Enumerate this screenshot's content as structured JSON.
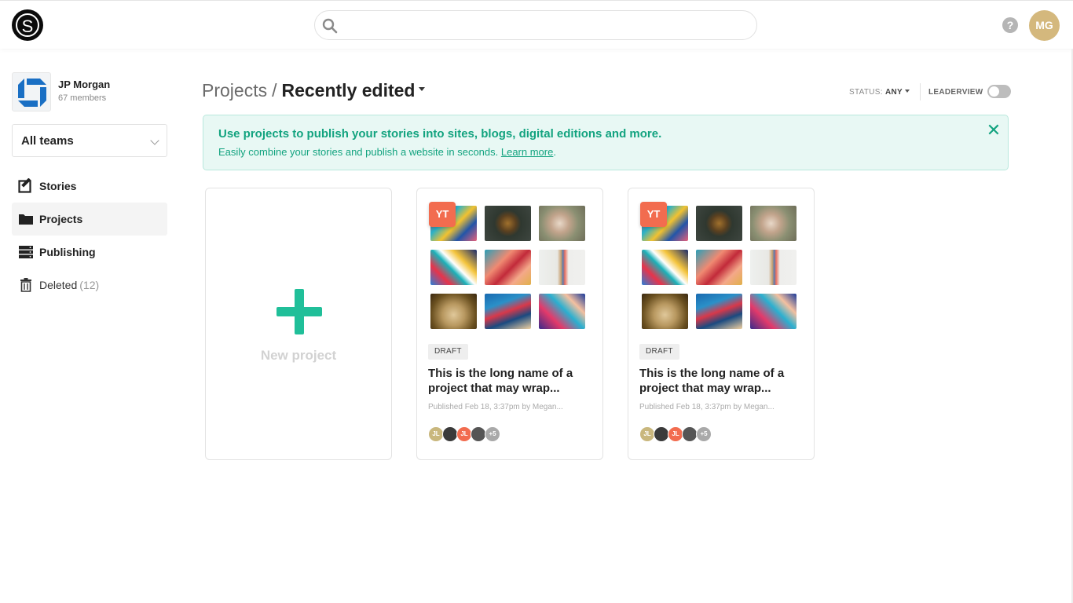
{
  "app": {
    "logo_letter": "S",
    "search_placeholder": "",
    "user_initials": "MG",
    "help_symbol": "?"
  },
  "org": {
    "name": "JP Morgan",
    "members": "67 members"
  },
  "sidebar": {
    "team_select": "All teams",
    "items": [
      {
        "label": "Stories",
        "icon": "edit-icon"
      },
      {
        "label": "Projects",
        "icon": "folder-icon",
        "active": true
      },
      {
        "label": "Publishing",
        "icon": "server-icon"
      },
      {
        "label": "Deleted",
        "icon": "trash-icon",
        "count": "(12)"
      }
    ]
  },
  "header": {
    "crumb_root": "Projects",
    "crumb_sep": "/",
    "crumb_current": "Recently edited",
    "status_label": "STATUS:",
    "status_value": "ANY",
    "leaderview_label": "LEADERVIEW",
    "leaderview_on": false
  },
  "banner": {
    "title": "Use projects to publish your stories into sites, blogs, digital editions and more.",
    "text": "Easily combine your stories and publish a website in seconds. ",
    "link": "Learn more",
    "text_end": ".",
    "close": "✕"
  },
  "new_project": {
    "label": "New project"
  },
  "projects": [
    {
      "badge": "YT",
      "status": "DRAFT",
      "title": "This is the long name of a project that may wrap...",
      "meta": "Published Feb 18, 3:37pm by Megan...",
      "members": [
        {
          "initials": "JL",
          "color": "#c9b77d"
        },
        {
          "initials": "",
          "color": "#3a3a3a"
        },
        {
          "initials": "JL",
          "color": "#f26c4f"
        },
        {
          "initials": "",
          "color": "#555555"
        },
        {
          "initials": "+5",
          "color": "#a9a9a9"
        }
      ]
    },
    {
      "badge": "YT",
      "status": "DRAFT",
      "title": "This is the long name of a project that may wrap...",
      "meta": "Published Feb 18, 3:37pm by Megan...",
      "members": [
        {
          "initials": "JL",
          "color": "#c9b77d"
        },
        {
          "initials": "",
          "color": "#3a3a3a"
        },
        {
          "initials": "JL",
          "color": "#f26c4f"
        },
        {
          "initials": "",
          "color": "#555555"
        },
        {
          "initials": "+5",
          "color": "#a9a9a9"
        }
      ]
    }
  ],
  "colors": {
    "accent": "#20bf99",
    "banner_text": "#12a37f",
    "badge": "#f26c4f"
  }
}
